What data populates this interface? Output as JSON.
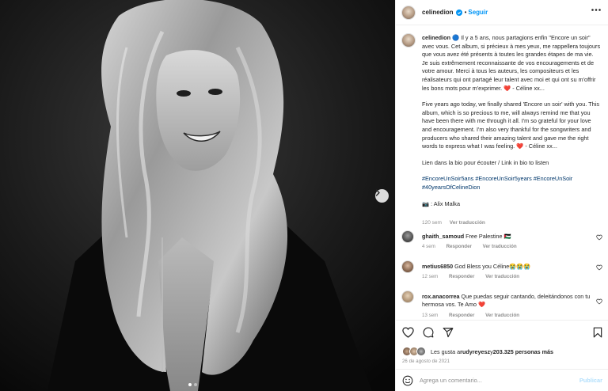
{
  "post": {
    "username": "celinedion",
    "follow_label": "Seguir",
    "separator": "•",
    "caption": {
      "username": "celinedion",
      "para_fr": "🔵 Il y a 5 ans, nous partagions enfin \"Encore un soir\" avec vous. Cet album, si précieux à mes yeux, me rappellera toujours que vous avez été présents à toutes les grandes étapes de ma vie. Je suis extrêmement reconnaissante de vos encouragements et de votre amour. Merci à tous les auteurs, les compositeurs et les réalisateurs qui ont partagé leur talent avec moi et qui ont su m'offrir les bons mots pour m'exprimer. ❤️ - Céline xx...",
      "para_en": "Five years ago today, we finally shared 'Encore un soir' with you. This album, which is so precious to me, will always remind me that you have been there with me through it all. I'm so grateful for your love and encouragement. I'm also very thankful for the songwriters and producers who shared their amazing talent and gave me the right words to express what I was feeling. ❤️ - Céline xx...",
      "link_line": "Lien dans la bio pour écouter / Link in bio to listen",
      "hashtags": "#EncoreUnSoir5ans #EncoreUnSoir5years #EncoreUnSoir #40yearsOfCelineDion",
      "photo_credit": "📷 : Alix Malka",
      "age": "120 sem",
      "see_translation": "Ver traducción"
    },
    "comments": [
      {
        "user": "ghaith_samoud",
        "text": "Free Palestine 🇵🇸",
        "age": "4 sem",
        "reply": "Responder",
        "translate": "Ver traducción"
      },
      {
        "user": "metius6850",
        "text": "God Bless you Céline😭😭😭",
        "age": "12 sem",
        "reply": "Responder",
        "translate": "Ver traducción"
      },
      {
        "user": "rox.anacorrea",
        "text": "Que puedas seguir cantando, deleitándonos con tu hermosa vos. Te Amo ❤️",
        "age": "13 sem",
        "reply": "Responder",
        "translate": "Ver traducción"
      }
    ],
    "likes": {
      "prefix": "Les gusta a ",
      "user": "rudyreyesz",
      "middle": " y ",
      "count": "203.325 personas más"
    },
    "date": "26 de agosto de 2021",
    "add_comment_placeholder": "Agrega un comentario...",
    "publish_label": "Publicar"
  },
  "carousel": {
    "dots": 2,
    "active_index": 0
  },
  "colors": {
    "accent": "#0095f6",
    "text": "#262626",
    "muted": "#8e8e8e",
    "like": "#ed4956",
    "hashtag": "#00376b"
  }
}
